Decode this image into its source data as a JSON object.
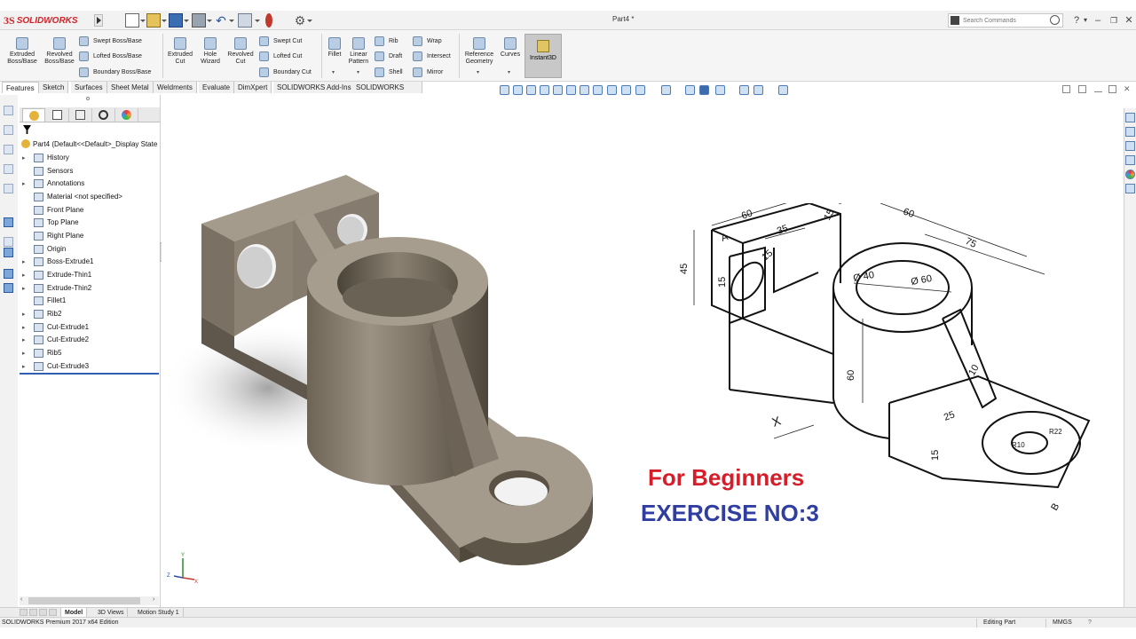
{
  "app": {
    "logo_ds": "3S",
    "logo_text": "SOLIDWORKS",
    "doc_title": "Part4 *",
    "search_placeholder": "Search Commands",
    "help_label": "?",
    "brand_color": "#d2232a"
  },
  "ribbon": {
    "extruded_boss": [
      "Extruded",
      "Boss/Base"
    ],
    "revolved_boss": [
      "Revolved",
      "Boss/Base"
    ],
    "swept_boss": "Swept Boss/Base",
    "lofted_boss": "Lofted Boss/Base",
    "boundary_boss": "Boundary Boss/Base",
    "extruded_cut": [
      "Extruded",
      "Cut"
    ],
    "hole_wizard": [
      "Hole",
      "Wizard"
    ],
    "revolved_cut": [
      "Revolved",
      "Cut"
    ],
    "swept_cut": "Swept Cut",
    "lofted_cut": "Lofted Cut",
    "boundary_cut": "Boundary Cut",
    "fillet": "Fillet",
    "linear_pattern": [
      "Linear",
      "Pattern"
    ],
    "rib": "Rib",
    "draft": "Draft",
    "shell": "Shell",
    "wrap": "Wrap",
    "intersect": "Intersect",
    "mirror": "Mirror",
    "reference_geometry": [
      "Reference",
      "Geometry"
    ],
    "curves": "Curves",
    "instant3d": "Instant3D"
  },
  "tabs": [
    "Features",
    "Sketch",
    "Surfaces",
    "Sheet Metal",
    "Weldments",
    "Evaluate",
    "DimXpert",
    "SOLIDWORKS Add-Ins",
    "SOLIDWORKS MBD"
  ],
  "feature_tree": {
    "root": "Part4  (Default<<Default>_Display State",
    "items": [
      {
        "label": "History",
        "expand": true,
        "icon": "history-icon"
      },
      {
        "label": "Sensors",
        "expand": false,
        "icon": "sensors-icon"
      },
      {
        "label": "Annotations",
        "expand": true,
        "icon": "annotations-icon"
      },
      {
        "label": "Material <not specified>",
        "expand": false,
        "icon": "material-icon"
      },
      {
        "label": "Front Plane",
        "expand": false,
        "icon": "plane-icon"
      },
      {
        "label": "Top Plane",
        "expand": false,
        "icon": "plane-icon"
      },
      {
        "label": "Right Plane",
        "expand": false,
        "icon": "plane-icon"
      },
      {
        "label": "Origin",
        "expand": false,
        "icon": "origin-icon"
      },
      {
        "label": "Boss-Extrude1",
        "expand": true,
        "icon": "extrude-icon"
      },
      {
        "label": "Extrude-Thin1",
        "expand": true,
        "icon": "extrude-icon"
      },
      {
        "label": "Extrude-Thin2",
        "expand": true,
        "icon": "extrude-icon"
      },
      {
        "label": "Fillet1",
        "expand": false,
        "icon": "fillet-icon"
      },
      {
        "label": "Rib2",
        "expand": true,
        "icon": "rib-icon"
      },
      {
        "label": "Cut-Extrude1",
        "expand": true,
        "icon": "cut-icon"
      },
      {
        "label": "Cut-Extrude2",
        "expand": true,
        "icon": "cut-icon"
      },
      {
        "label": "Rib5",
        "expand": true,
        "icon": "rib-icon"
      },
      {
        "label": "Cut-Extrude3",
        "expand": true,
        "icon": "cut-icon"
      }
    ]
  },
  "overlay": {
    "line1": "For Beginners",
    "line2": "EXERCISE NO:3",
    "line1_color": "#d51e2a",
    "line2_color": "#2f3ea0"
  },
  "drawing_dims": {
    "d60_top": "60",
    "d15_top": "15",
    "d35": "35",
    "d15_a": "15",
    "d45": "45",
    "d15_b": "15",
    "d15_c": "15",
    "d60_right": "60",
    "d75": "75",
    "d40": "Ø 40",
    "d60_dia": "Ø 60",
    "d60_vert": "60",
    "d10": "10",
    "d25": "25",
    "d15_d": "15",
    "r10": "R10",
    "r22": "R22",
    "label_a": "A",
    "label_b": "B",
    "label_x": "X"
  },
  "triad": {
    "y": "Y",
    "z": "Z",
    "x": "X"
  },
  "bottom_tabs": [
    "Model",
    "3D Views",
    "Motion Study 1"
  ],
  "status": {
    "edition": "SOLIDWORKS Premium 2017 x64 Edition",
    "mode": "Editing Part",
    "units": "MMGS",
    "help": "?"
  }
}
